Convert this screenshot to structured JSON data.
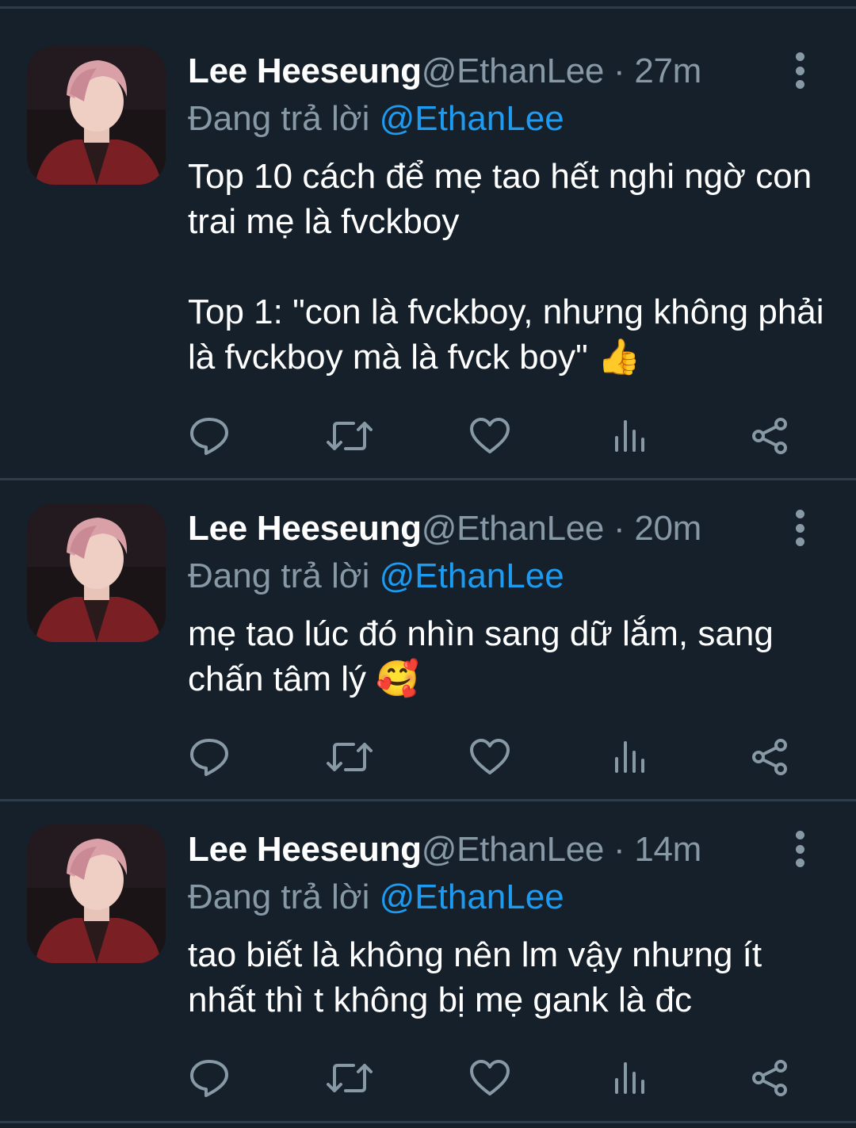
{
  "colors": {
    "background": "#15202b",
    "separator": "#2f3d4a",
    "muted": "#8899a6",
    "mention": "#1d9bf0",
    "text": "#ffffff"
  },
  "tweets": [
    {
      "name": "Lee Heeseung",
      "handle": "@EthanLee",
      "dot": " · ",
      "time": "27m",
      "reply_prefix": "Đang trả lời ",
      "reply_mention": "@EthanLee",
      "text": "Top 10 cách để mẹ tao hết nghi ngờ con trai mẹ là fvckboy\n\nTop 1: \"con là fvckboy, nhưng không phải là fvckboy mà là fvck boy\" 👍"
    },
    {
      "name": "Lee Heeseung",
      "handle": "@EthanLee",
      "dot": " · ",
      "time": "20m",
      "reply_prefix": "Đang trả lời ",
      "reply_mention": "@EthanLee",
      "text": "mẹ tao lúc đó nhìn sang dữ lắm, sang chấn tâm lý 🥰"
    },
    {
      "name": "Lee Heeseung",
      "handle": "@EthanLee",
      "dot": " · ",
      "time": "14m",
      "reply_prefix": "Đang trả lời ",
      "reply_mention": "@EthanLee",
      "text": "tao biết là không nên lm vậy nhưng ít nhất thì t không bị mẹ gank là đc"
    }
  ],
  "action_icons": [
    "reply-icon",
    "retweet-icon",
    "like-icon",
    "analytics-icon",
    "share-icon"
  ]
}
